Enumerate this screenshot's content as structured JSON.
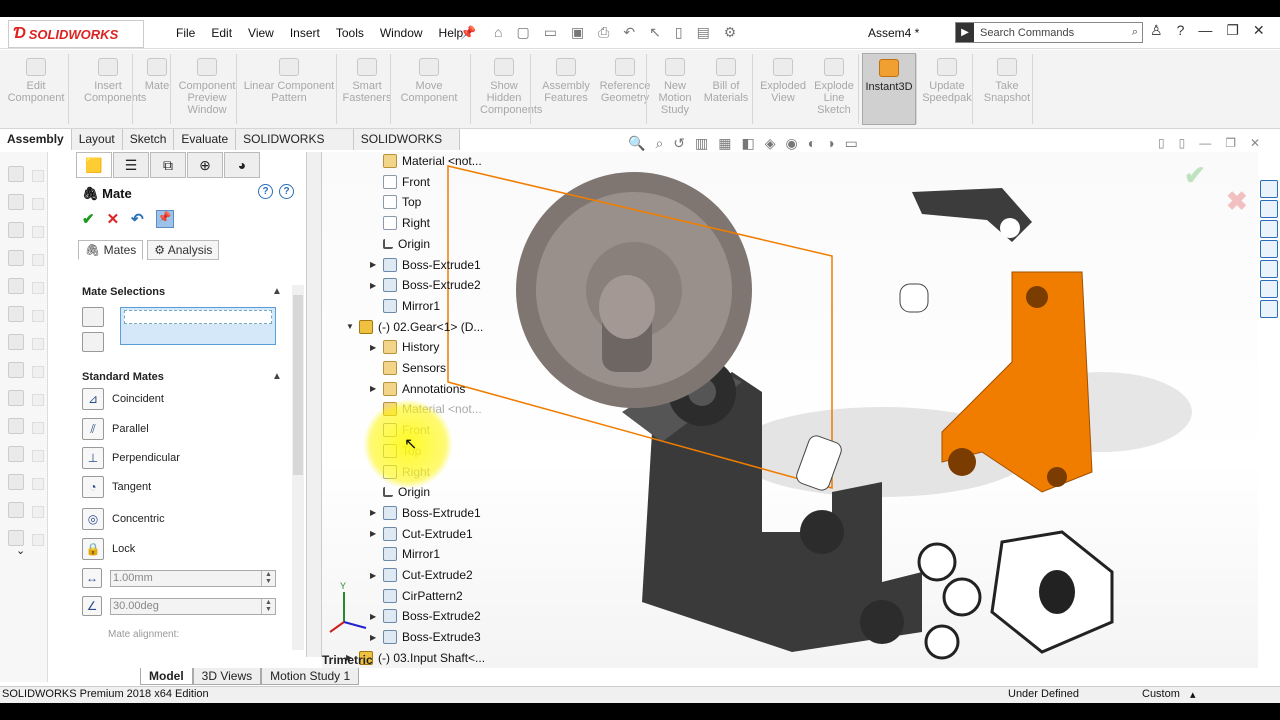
{
  "app": {
    "brand": "SOLIDWORKS",
    "doc_title": "Assem4 *"
  },
  "menu": [
    "File",
    "Edit",
    "View",
    "Insert",
    "Tools",
    "Window",
    "Help"
  ],
  "search": {
    "placeholder": "Search Commands"
  },
  "ribbon": [
    {
      "label": "Edit\nComponent",
      "enabled": false
    },
    {
      "label": "Insert\nComponents",
      "enabled": false
    },
    {
      "label": "Mate",
      "enabled": false
    },
    {
      "label": "Component\nPreview\nWindow",
      "enabled": false
    },
    {
      "label": "Linear Component\nPattern",
      "enabled": false
    },
    {
      "label": "Smart\nFasteners",
      "enabled": false
    },
    {
      "label": "Move\nComponent",
      "enabled": false
    },
    {
      "label": "Show\nHidden\nComponents",
      "enabled": false
    },
    {
      "label": "Assembly\nFeatures",
      "enabled": false
    },
    {
      "label": "Reference\nGeometry",
      "enabled": false
    },
    {
      "label": "New\nMotion\nStudy",
      "enabled": false
    },
    {
      "label": "Bill of\nMaterials",
      "enabled": false
    },
    {
      "label": "Exploded\nView",
      "enabled": false
    },
    {
      "label": "Explode\nLine\nSketch",
      "enabled": false
    },
    {
      "label": "Instant3D",
      "enabled": true,
      "active": true
    },
    {
      "label": "Update\nSpeedpak",
      "enabled": false
    },
    {
      "label": "Take\nSnapshot",
      "enabled": false
    }
  ],
  "tabs": [
    "Assembly",
    "Layout",
    "Sketch",
    "Evaluate",
    "SOLIDWORKS Add-Ins",
    "SOLIDWORKS MBD"
  ],
  "pm": {
    "title": "Mate",
    "subtabs": [
      "Mates",
      "Analysis"
    ],
    "mate_selections": "Mate Selections",
    "standard_mates": "Standard Mates",
    "mates": [
      "Coincident",
      "Parallel",
      "Perpendicular",
      "Tangent",
      "Concentric",
      "Lock"
    ],
    "distance": "1.00mm",
    "angle": "30.00deg",
    "mate_alignment": "Mate alignment:"
  },
  "tree": [
    {
      "label": "Material <not...",
      "icon": "folder",
      "exp": false
    },
    {
      "label": "Front",
      "icon": "plane"
    },
    {
      "label": "Top",
      "icon": "plane"
    },
    {
      "label": "Right",
      "icon": "plane"
    },
    {
      "label": "Origin",
      "icon": "orig"
    },
    {
      "label": "Boss-Extrude1",
      "icon": "feat",
      "exp": true
    },
    {
      "label": "Boss-Extrude2",
      "icon": "feat",
      "exp": true
    },
    {
      "label": "Mirror1",
      "icon": "feat"
    },
    {
      "label": "(-) 02.Gear<1> (D...",
      "icon": "part",
      "exp": "open"
    },
    {
      "label": "History",
      "icon": "folder",
      "exp": true
    },
    {
      "label": "Sensors",
      "icon": "folder"
    },
    {
      "label": "Annotations",
      "icon": "folder",
      "exp": true
    },
    {
      "label": "Material <not...",
      "icon": "folder",
      "faded": true
    },
    {
      "label": "Front",
      "icon": "plane",
      "faded": true
    },
    {
      "label": "Top",
      "icon": "plane",
      "faded": true
    },
    {
      "label": "Right",
      "icon": "plane",
      "faded": true
    },
    {
      "label": "Origin",
      "icon": "orig"
    },
    {
      "label": "Boss-Extrude1",
      "icon": "feat",
      "exp": true
    },
    {
      "label": "Cut-Extrude1",
      "icon": "feat",
      "exp": true
    },
    {
      "label": "Mirror1",
      "icon": "feat"
    },
    {
      "label": "Cut-Extrude2",
      "icon": "feat",
      "exp": true
    },
    {
      "label": "CirPattern2",
      "icon": "feat"
    },
    {
      "label": "Boss-Extrude2",
      "icon": "feat",
      "exp": true
    },
    {
      "label": "Boss-Extrude3",
      "icon": "feat",
      "exp": true
    },
    {
      "label": "(-) 03.Input Shaft<...",
      "icon": "part",
      "exp": true
    }
  ],
  "trim_label": "Trimetric",
  "bottom_tabs": [
    "Model",
    "3D Views",
    "Motion Study 1"
  ],
  "status": {
    "edition": "SOLIDWORKS Premium 2018 x64 Edition",
    "state": "Under Defined",
    "units": "Custom"
  },
  "colors": {
    "accent_orange": "#f07d00",
    "gear": "#8a7f7a",
    "dark_part": "#3a3a3a"
  }
}
